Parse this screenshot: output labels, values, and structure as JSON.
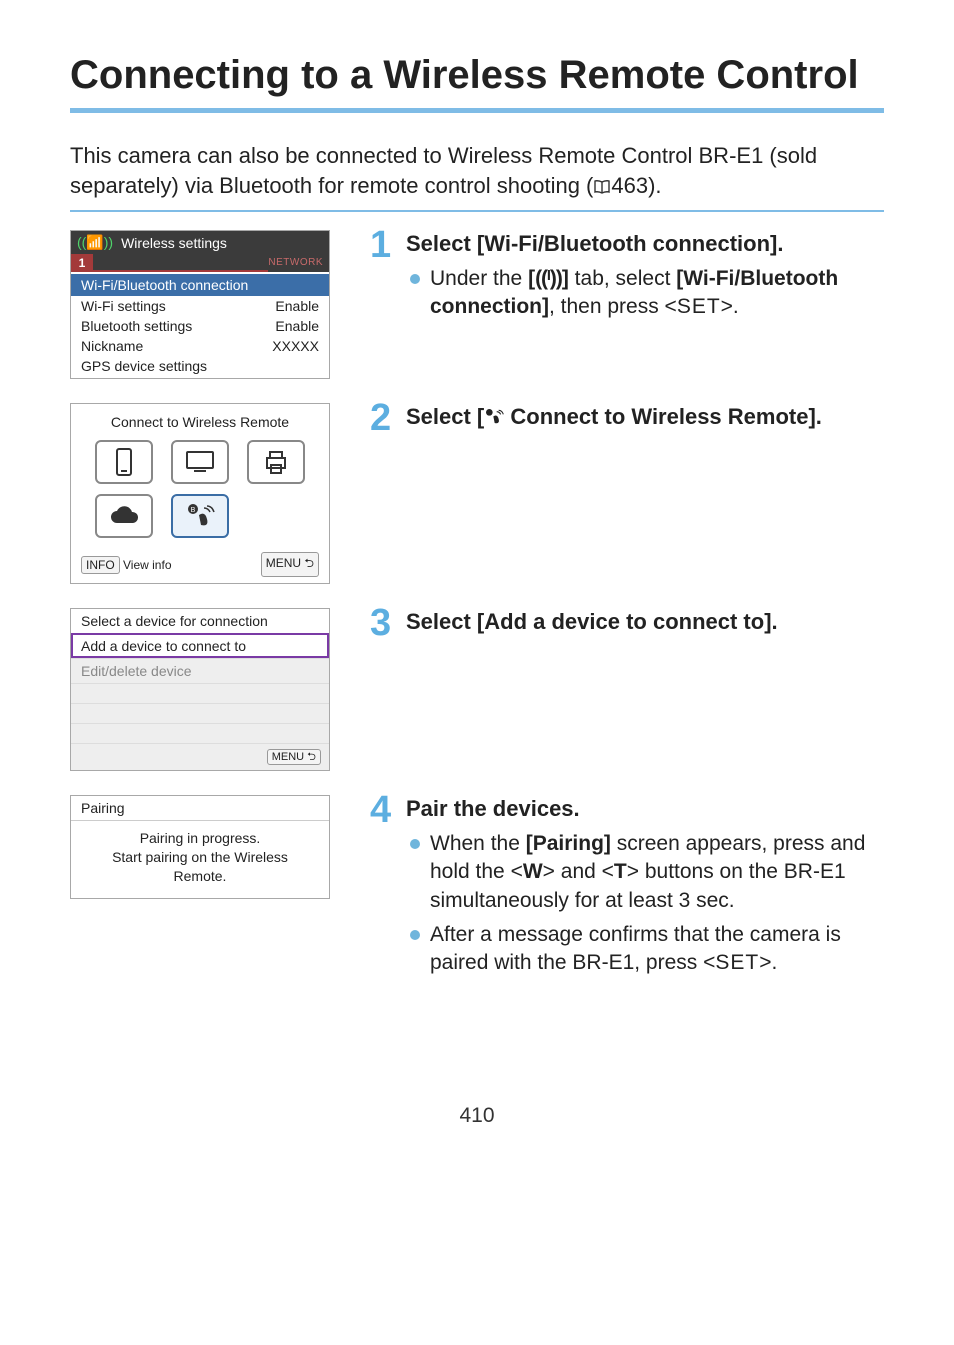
{
  "title": "Connecting to a Wireless Remote Control",
  "intro_a": "This camera can also be connected to Wireless Remote Control BR-E1 (sold separately) via Bluetooth for remote control shooting (",
  "intro_ref": "463",
  "intro_b": ").",
  "page_number": "410",
  "shot1": {
    "header": "Wireless settings",
    "tab": "1",
    "tab_label": "NETWORK",
    "rows": [
      {
        "label": "Wi-Fi/Bluetooth connection",
        "value": "",
        "selected": true
      },
      {
        "label": "Wi-Fi settings",
        "value": "Enable"
      },
      {
        "label": "Bluetooth settings",
        "value": "Enable"
      },
      {
        "label": "Nickname",
        "value": "XXXXX"
      },
      {
        "label": "GPS device settings",
        "value": ""
      }
    ]
  },
  "shot2": {
    "header": "Connect to Wireless Remote",
    "info_label": "INFO",
    "info_text": "View info",
    "menu_label": "MENU",
    "icons": [
      {
        "name": "smartphone-icon"
      },
      {
        "name": "monitor-icon"
      },
      {
        "name": "printer-icon"
      },
      {
        "name": "cloud-icon"
      },
      {
        "name": "bt-remote-icon",
        "selected": true
      }
    ]
  },
  "shot3": {
    "header": "Select a device for connection",
    "item_selected": "Add a device to connect to",
    "item_disabled": "Edit/delete device",
    "menu_label": "MENU"
  },
  "shot4": {
    "header": "Pairing",
    "line1": "Pairing in progress.",
    "line2": "Start pairing on the Wireless",
    "line3": "Remote."
  },
  "step1": {
    "num": "1",
    "head": "Select [Wi-Fi/Bluetooth connection].",
    "b1a": "Under the ",
    "b1b": " tab, select ",
    "b1c": "[Wi-Fi/Bluetooth connection]",
    "b1d": ", then press <",
    "b1set": "SET",
    "b1e": ">."
  },
  "step2": {
    "num": "2",
    "head_a": "Select [",
    "head_b": " Connect to Wireless Remote]."
  },
  "step3": {
    "num": "3",
    "head": "Select [Add a device to connect to]."
  },
  "step4": {
    "num": "4",
    "head": "Pair the devices.",
    "b1a": "When the ",
    "b1b": "[Pairing]",
    "b1c": " screen appears, press and hold the <",
    "b1w": "W",
    "b1d": "> and <",
    "b1t": "T",
    "b1e": "> buttons on the BR-E1 simultaneously for at least 3 sec.",
    "b2a": "After a message confirms that the camera is paired with the BR-E1, press <",
    "b2set": "SET",
    "b2b": ">."
  }
}
